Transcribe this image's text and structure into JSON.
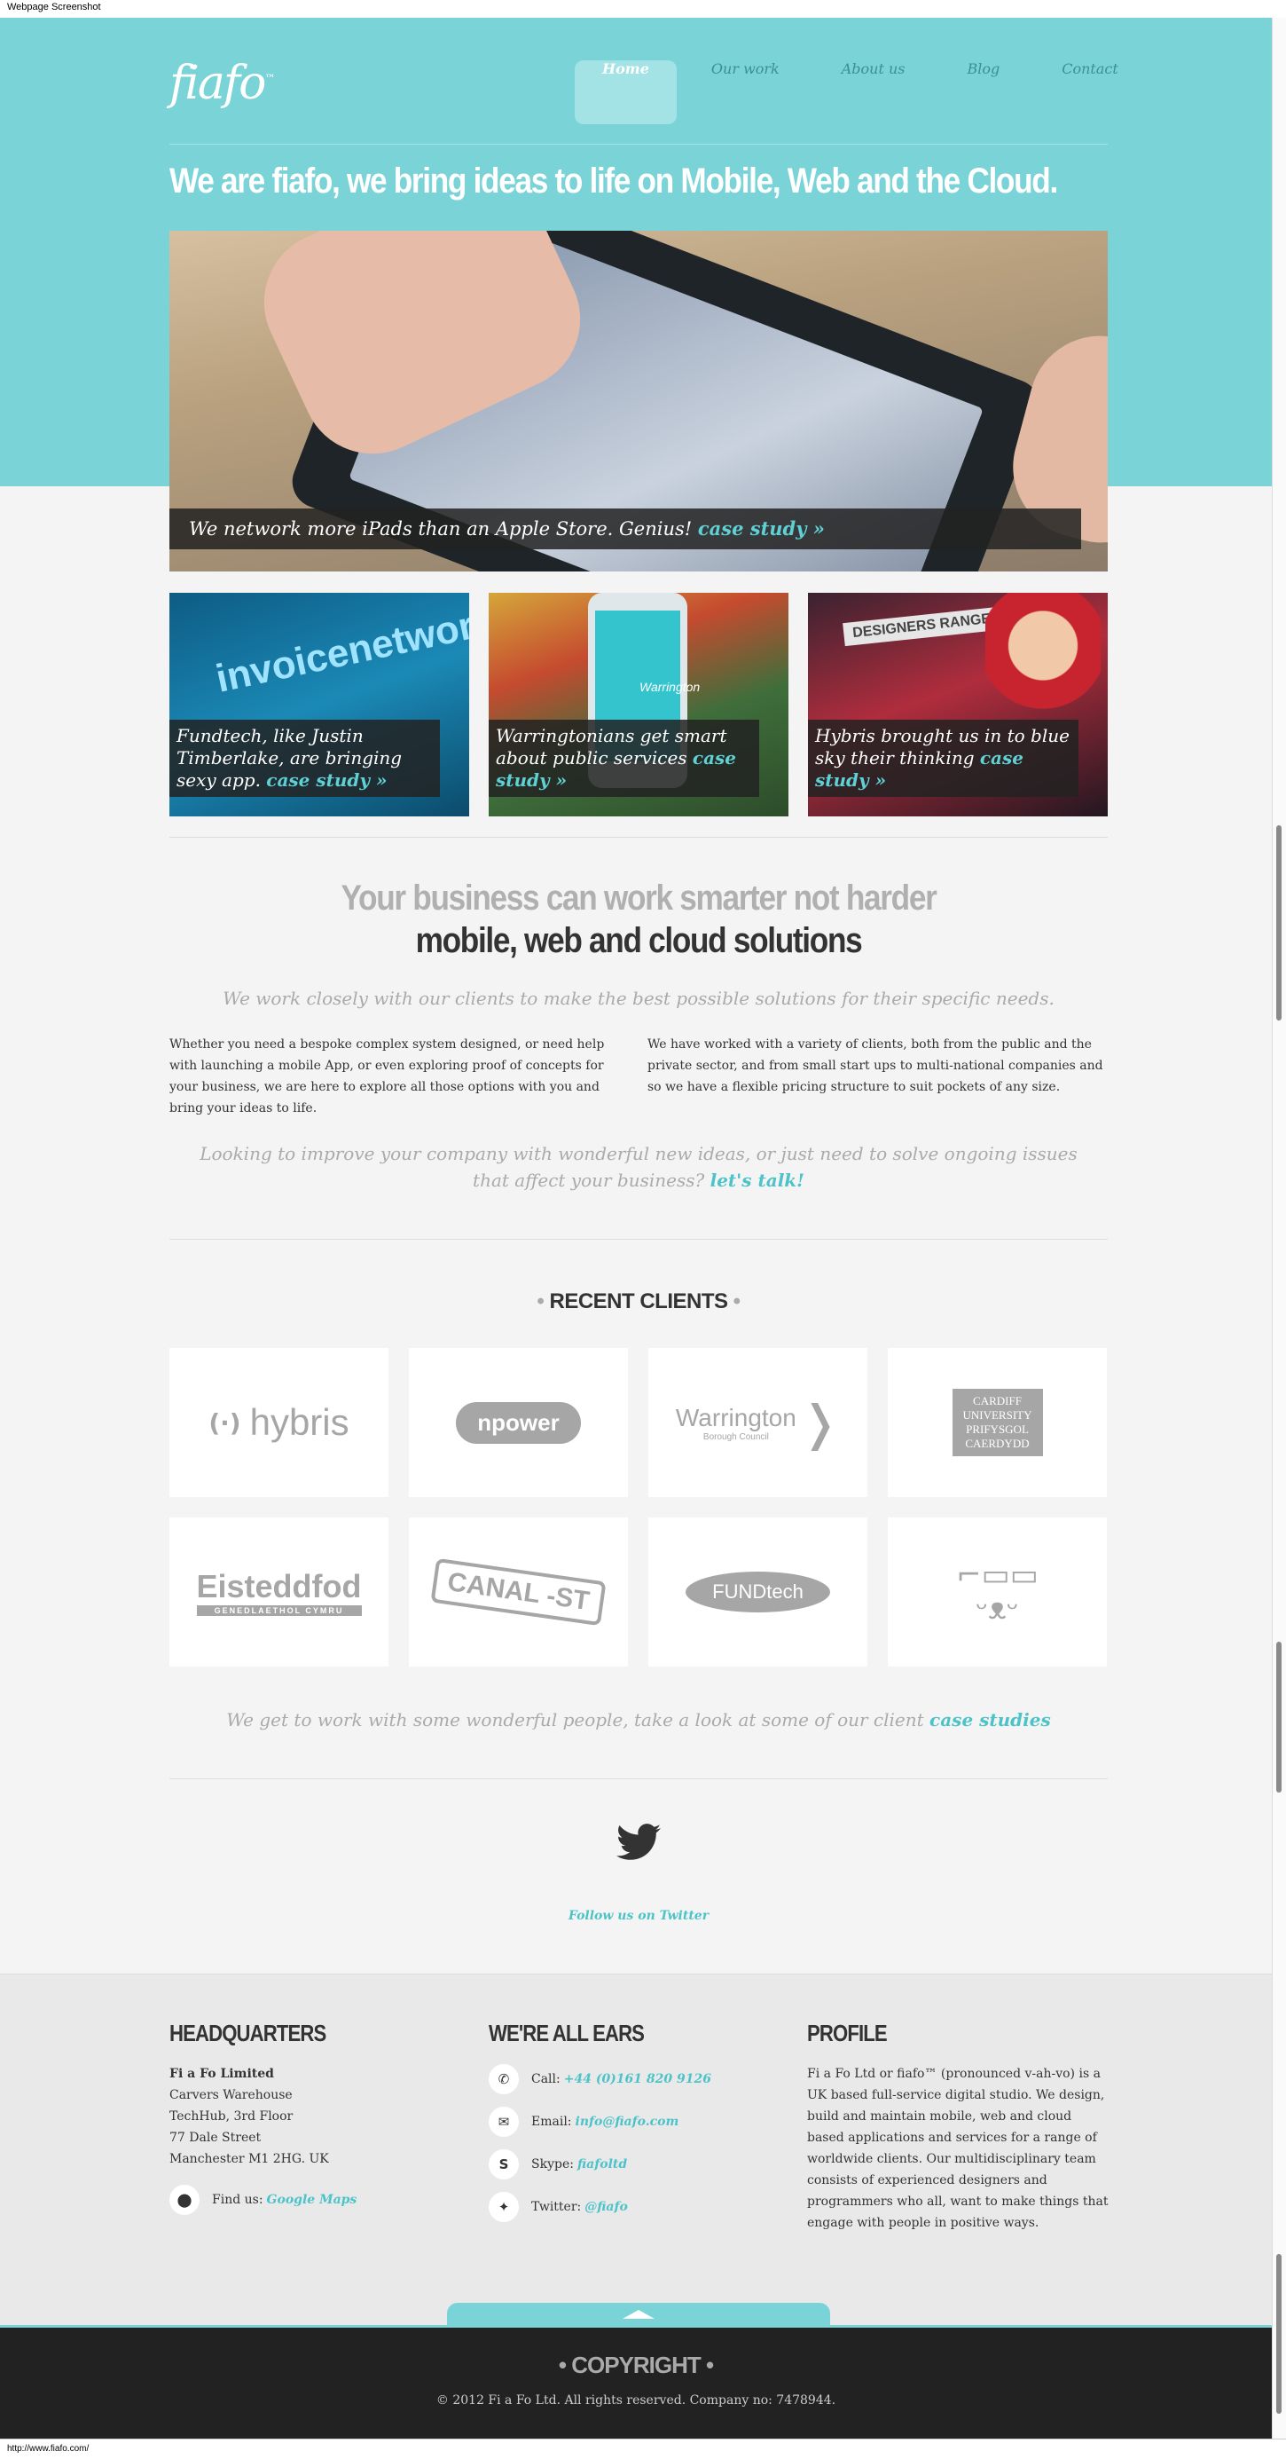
{
  "window": {
    "title": "Webpage Screenshot",
    "status_url": "http://www.fiafo.com/"
  },
  "brand": {
    "logo": "fiafo",
    "tm": "™"
  },
  "nav": [
    {
      "label": "Home",
      "active": true
    },
    {
      "label": "Our work",
      "active": false
    },
    {
      "label": "About us",
      "active": false
    },
    {
      "label": "Blog",
      "active": false
    },
    {
      "label": "Contact",
      "active": false
    }
  ],
  "hero": {
    "title": "We are fiafo, we bring ideas to life on Mobile, Web and the Cloud.",
    "feature_caption": "We network more iPads than an Apple Store. Genius! ",
    "feature_link": "case study »"
  },
  "tiles": [
    {
      "caption": "Fundtech, like Justin Timberlake, are bringing sexy app. ",
      "link": "case study »",
      "art_text": "invoicenetwork"
    },
    {
      "caption": "Warringtonians get smart about public services ",
      "link": "case study »",
      "art_text": "Warrington"
    },
    {
      "caption": "Hybris brought us in to blue sky their thinking ",
      "link": "case study »",
      "art_text": "DESIGNERS RANGE"
    }
  ],
  "intro": {
    "tagline_light": "Your business can work smarter not harder",
    "tagline_dark": "mobile, web and cloud solutions",
    "lead": "We work closely with our clients to make the best possible solutions for their specific needs.",
    "col_left": "Whether you need a bespoke complex system designed, or need help with launching a mobile App, or even exploring proof of concepts for your business, we are here to explore all those options with you and bring your ideas to life.",
    "col_right": "We have worked with a variety of clients, both from the public and the private sector, and from small start ups to multi-national companies and so we have a flexible pricing structure to suit pockets of any size.",
    "cta": "Looking to improve your company with wonderful new ideas, or just need to solve ongoing issues that affect your business? ",
    "cta_link": "let's talk!"
  },
  "clients": {
    "heading": "RECENT CLIENTS",
    "logos": [
      "hybris",
      "npower",
      "Warrington",
      "CARDIFF UNIVERSITY PRIFYSGOL CAERDYDD",
      "Eisteddfod",
      "CANAL -ST",
      "FUNDtech",
      ""
    ],
    "logo_sub": {
      "warrington": "Borough Council",
      "eisteddfod": "GENEDLAETHOL CYMRU"
    },
    "closing": "We get to work with some wonderful people, take a look at some of our client ",
    "closing_link": "case studies"
  },
  "twitter": {
    "follow": "Follow us on Twitter"
  },
  "footer": {
    "hq": {
      "heading": "HEADQUARTERS",
      "company": "Fi a Fo Limited",
      "lines": [
        "Carvers Warehouse",
        "TechHub, 3rd Floor",
        "77 Dale Street",
        "Manchester M1 2HG. UK"
      ],
      "maps_label": "Find us:",
      "maps_link": "Google Maps"
    },
    "contact": {
      "heading": "WE'RE ALL EARS",
      "call_label": "Call:",
      "call": "+44 (0)161 820 9126",
      "email_label": "Email:",
      "email": "info@fiafo.com",
      "skype_label": "Skype:",
      "skype": "fiafoltd",
      "twitter_label": "Twitter:",
      "twitter": "@fiafo"
    },
    "profile": {
      "heading": "PROFILE",
      "text": "Fi a Fo Ltd or fiafo™ (pronounced v-ah-vo) is a UK based full-service digital studio. We design, build and maintain mobile, web and cloud based applications and services for a range of worldwide clients. Our multidisciplinary team consists of experienced designers and programmers who all, want to make things that engage with people in positive ways."
    },
    "copyright_heading": "COPYRIGHT",
    "copyright": "© 2012 Fi a Fo Ltd. All rights reserved. Company no: 7478944."
  },
  "colors": {
    "accent": "#79d3d7",
    "link": "#4cc3c8",
    "dark": "#222222",
    "background": "#f4f4f4"
  }
}
